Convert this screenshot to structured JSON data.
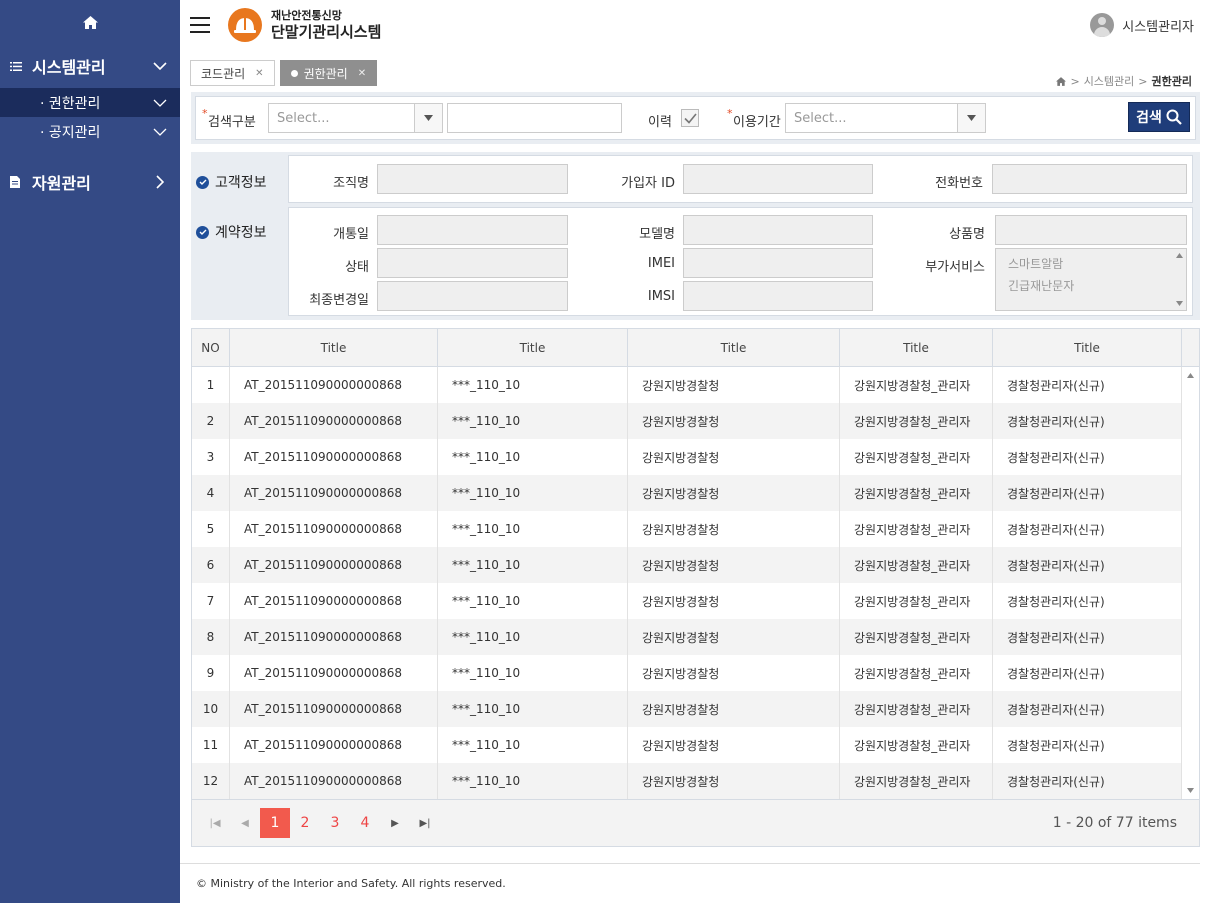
{
  "sidebar": {
    "menus": [
      {
        "label": "시스템관리",
        "expanded": true,
        "items": [
          {
            "label": "· 권한관리",
            "active": true
          },
          {
            "label": "· 공지관리",
            "active": false
          }
        ]
      },
      {
        "label": "자원관리",
        "expanded": false
      }
    ]
  },
  "header": {
    "brand_sub": "재난안전통신망",
    "brand_main": "단말기관리시스템",
    "user_name": "시스템관리자"
  },
  "tabs": [
    {
      "label": "코드관리",
      "active": false
    },
    {
      "label": "권한관리",
      "active": true
    }
  ],
  "breadcrumb": {
    "parts": [
      "시스템관리"
    ],
    "current": "권한관리",
    "separator": ">"
  },
  "search": {
    "category_label": "검색구분",
    "category_placeholder": "Select...",
    "history_label": "이력",
    "history_checked": true,
    "period_label": "이용기간",
    "period_placeholder": "Select...",
    "button_label": "검색"
  },
  "customer_info": {
    "title": "고객정보",
    "fields": {
      "org": "조직명",
      "subscriber": "가입자 ID",
      "phone": "전화번호"
    }
  },
  "contract_info": {
    "title": "계약정보",
    "fields": {
      "open_date": "개통일",
      "model": "모델명",
      "product": "상품명",
      "status": "상태",
      "imei": "IMEI",
      "extra_service": "부가서비스",
      "last_modified": "최종변경일",
      "imsi": "IMSI"
    },
    "extra_services": [
      "스마트알람",
      "긴급재난문자"
    ]
  },
  "grid": {
    "columns": [
      "NO",
      "Title",
      "Title",
      "Title",
      "Title",
      "Title"
    ],
    "rows": [
      [
        "1",
        "AT_201511090000000868",
        "***_110_10",
        "강원지방경찰청",
        "강원지방경찰청_관리자",
        "경찰청관리자(신규)"
      ],
      [
        "2",
        "AT_201511090000000868",
        "***_110_10",
        "강원지방경찰청",
        "강원지방경찰청_관리자",
        "경찰청관리자(신규)"
      ],
      [
        "3",
        "AT_201511090000000868",
        "***_110_10",
        "강원지방경찰청",
        "강원지방경찰청_관리자",
        "경찰청관리자(신규)"
      ],
      [
        "4",
        "AT_201511090000000868",
        "***_110_10",
        "강원지방경찰청",
        "강원지방경찰청_관리자",
        "경찰청관리자(신규)"
      ],
      [
        "5",
        "AT_201511090000000868",
        "***_110_10",
        "강원지방경찰청",
        "강원지방경찰청_관리자",
        "경찰청관리자(신규)"
      ],
      [
        "6",
        "AT_201511090000000868",
        "***_110_10",
        "강원지방경찰청",
        "강원지방경찰청_관리자",
        "경찰청관리자(신규)"
      ],
      [
        "7",
        "AT_201511090000000868",
        "***_110_10",
        "강원지방경찰청",
        "강원지방경찰청_관리자",
        "경찰청관리자(신규)"
      ],
      [
        "8",
        "AT_201511090000000868",
        "***_110_10",
        "강원지방경찰청",
        "강원지방경찰청_관리자",
        "경찰청관리자(신규)"
      ],
      [
        "9",
        "AT_201511090000000868",
        "***_110_10",
        "강원지방경찰청",
        "강원지방경찰청_관리자",
        "경찰청관리자(신규)"
      ],
      [
        "10",
        "AT_201511090000000868",
        "***_110_10",
        "강원지방경찰청",
        "강원지방경찰청_관리자",
        "경찰청관리자(신규)"
      ],
      [
        "11",
        "AT_201511090000000868",
        "***_110_10",
        "강원지방경찰청",
        "강원지방경찰청_관리자",
        "경찰청관리자(신규)"
      ],
      [
        "12",
        "AT_201511090000000868",
        "***_110_10",
        "강원지방경찰청",
        "강원지방경찰청_관리자",
        "경찰청관리자(신규)"
      ]
    ]
  },
  "pager": {
    "pages": [
      "1",
      "2",
      "3",
      "4"
    ],
    "current": "1",
    "info": "1 - 20 of 77 items"
  },
  "footer": {
    "copyright": "© Ministry of the Interior and Safety. All rights reserved."
  },
  "colors": {
    "sidebar": "#344a85",
    "sidebar_active": "#1b2c5c",
    "search_button": "#1f3d7a",
    "page_active": "#f25a4d",
    "logo": "#e8771e"
  }
}
